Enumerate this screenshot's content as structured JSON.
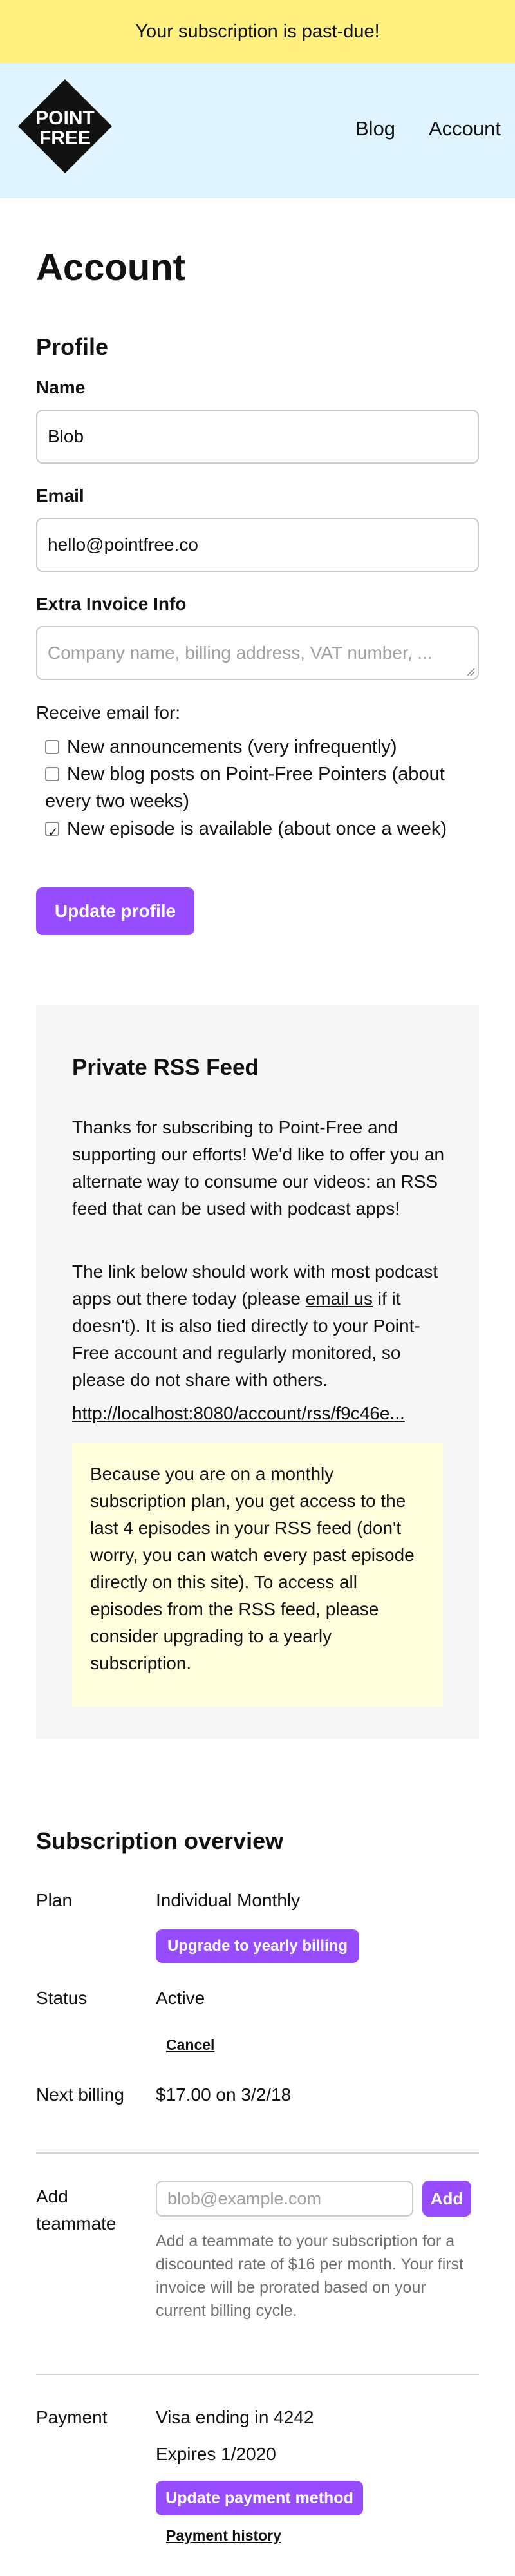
{
  "banner": {
    "text": "Your subscription is past-due!"
  },
  "header": {
    "logo_top": "POINT",
    "logo_bottom": "FREE",
    "nav": [
      {
        "label": "Blog"
      },
      {
        "label": "Account"
      }
    ]
  },
  "account": {
    "title": "Account",
    "profile": {
      "heading": "Profile",
      "name_label": "Name",
      "name_value": "Blob",
      "email_label": "Email",
      "email_value": "hello@pointfree.co",
      "invoice_label": "Extra Invoice Info",
      "invoice_placeholder": "Company name, billing address, VAT number, ...",
      "receive_label": "Receive email for:",
      "options": [
        {
          "label": "New announcements (very infrequently)",
          "checked": false
        },
        {
          "label": "New blog posts on Point-Free Pointers (about every two weeks)",
          "checked": false
        },
        {
          "label": "New episode is available (about once a week)",
          "checked": true
        }
      ],
      "update_button": "Update profile"
    },
    "rss": {
      "heading": "Private RSS Feed",
      "paragraph1": "Thanks for subscribing to Point-Free and supporting our efforts! We'd like to offer you an alternate way to consume our videos: an RSS feed that can be used with podcast apps!",
      "paragraph2_before": "The link below should work with most podcast apps out there today (please ",
      "paragraph2_link": "email us",
      "paragraph2_after": " if it doesn't). It is also tied directly to your Point-Free account and regularly monitored, so please do not share with others.",
      "feed_url": "http://localhost:8080/account/rss/f9c46e...",
      "notice": "Because you are on a monthly subscription plan, you get access to the last 4 episodes in your RSS feed (don't worry, you can watch every past episode directly on this site). To access all episodes from the RSS feed, please consider upgrading to a yearly subscription."
    },
    "subscription": {
      "heading": "Subscription overview",
      "plan_label": "Plan",
      "plan_value": "Individual Monthly",
      "upgrade_button": "Upgrade to yearly billing",
      "status_label": "Status",
      "status_value": "Active",
      "cancel_link": "Cancel",
      "billing_label": "Next billing",
      "billing_value": "$17.00 on 3/2/18",
      "teammate_label_line1": "Add",
      "teammate_label_line2": "teammate",
      "teammate_placeholder": "blob@example.com",
      "add_button": "Add",
      "teammate_help": "Add a teammate to your subscription for a discounted rate of $16 per month. Your first invoice will be prorated based on your current billing cycle.",
      "payment_label": "Payment",
      "card_value": "Visa ending in 4242",
      "expires_value": "Expires 1/2020",
      "update_payment_button": "Update payment method",
      "history_link": "Payment history"
    }
  },
  "colors": {
    "accent": "#974dff",
    "banner": "#fff080",
    "header": "#e0f4ff",
    "notice": "#ffffdd",
    "panel": "#f6f6f6"
  }
}
